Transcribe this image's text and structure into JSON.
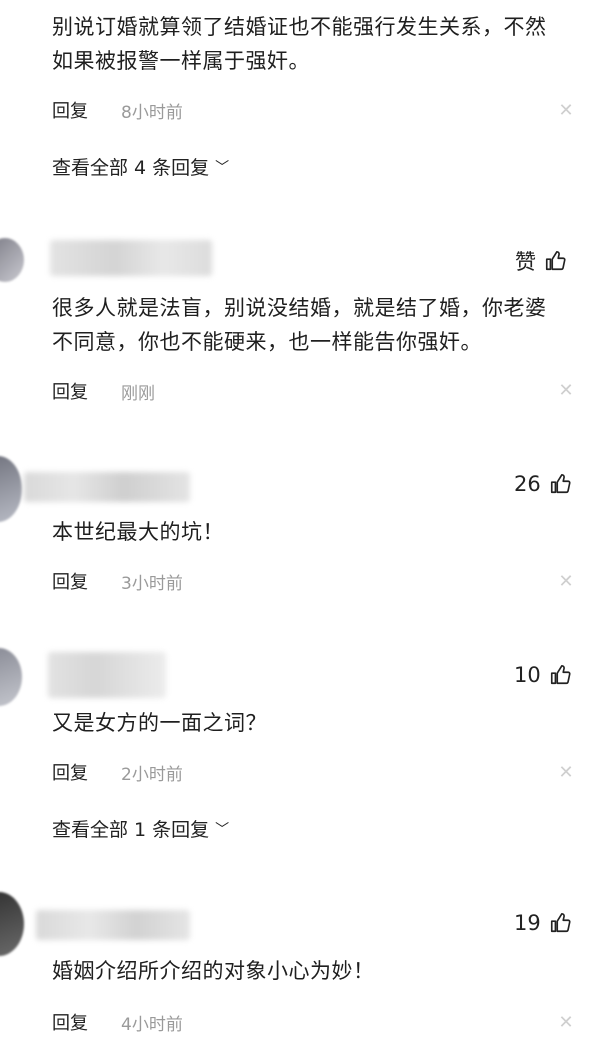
{
  "comments": [
    {
      "text_line1": "别说订婚就算领了结婚证也不能强行发生关系，不然",
      "text_line2": "如果被报警一样属于强奸。",
      "reply_label": "回复",
      "time": "8小时前",
      "expand_label": "查看全部 4 条回复"
    },
    {
      "like_label": "赞",
      "text_line1": "很多人就是法盲，别说没结婚，就是结了婚，你老婆",
      "text_line2": "不同意，你也不能硬来，也一样能告你强奸。",
      "reply_label": "回复",
      "time": "刚刚"
    },
    {
      "like_count": "26",
      "text_line1": "本世纪最大的坑！",
      "reply_label": "回复",
      "time": "3小时前"
    },
    {
      "like_count": "10",
      "text_line1": "又是女方的一面之词？",
      "reply_label": "回复",
      "time": "2小时前",
      "expand_label": "查看全部 1 条回复"
    },
    {
      "like_count": "19",
      "text_line1": "婚姻介绍所介绍的对象小心为妙！",
      "reply_label": "回复",
      "time": "4小时前"
    }
  ],
  "icons": {
    "like": "thumbs-up-icon",
    "close": "close-icon",
    "chevron": "chevron-down-icon"
  },
  "colors": {
    "text": "#1f1f1f",
    "meta": "#9a9a9a",
    "close": "#cfcfcf"
  }
}
